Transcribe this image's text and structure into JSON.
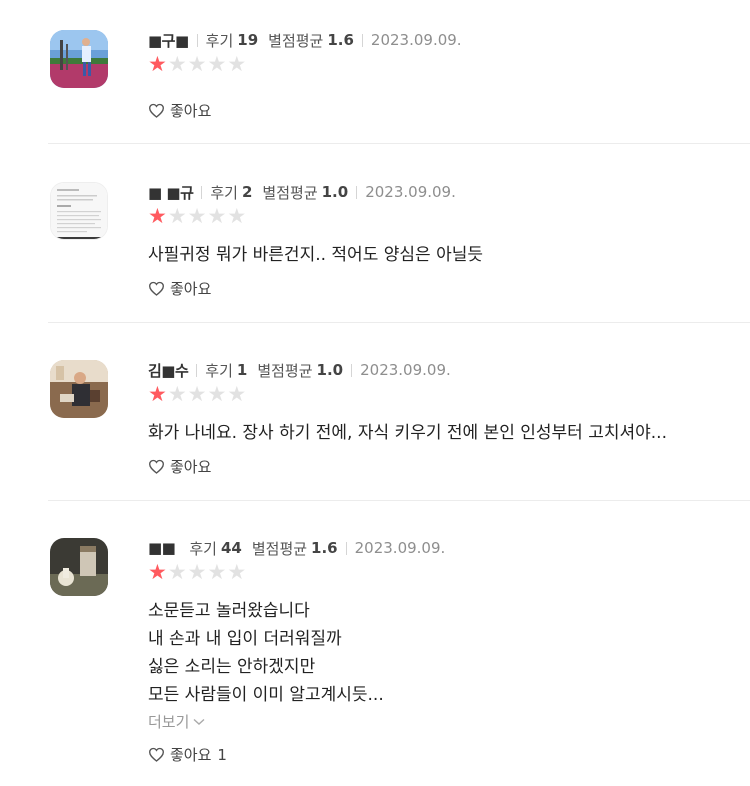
{
  "labels": {
    "reviews_prefix": "후기",
    "rating_avg_prefix": "별점평균",
    "like_label": "좋아요",
    "more_label": "더보기"
  },
  "colors": {
    "star_filled": "#ff5a5f",
    "star_empty": "#e2e2e2",
    "divider": "#ececec"
  },
  "reviews": [
    {
      "username": "■구■",
      "review_count": "19",
      "avg_rating": "1.6",
      "date": "2023.09.09.",
      "stars_filled": 1,
      "stars_total": 5,
      "text_lines": [],
      "like_count": "",
      "avatar_icon": "avatar-photo-person-outdoor"
    },
    {
      "username": "■ ■규",
      "review_count": "2",
      "avg_rating": "1.0",
      "date": "2023.09.09.",
      "stars_filled": 1,
      "stars_total": 5,
      "text_lines": [
        "사필귀정 뭐가 바른건지.. 적어도 양심은 아닐듯"
      ],
      "like_count": "",
      "avatar_icon": "avatar-document-image"
    },
    {
      "username": "김■수",
      "review_count": "1",
      "avg_rating": "1.0",
      "date": "2023.09.09.",
      "stars_filled": 1,
      "stars_total": 5,
      "text_lines": [
        "화가 나네요. 장사 하기 전에, 자식 키우기 전에 본인 인성부터 고치셔야..."
      ],
      "like_count": "",
      "avatar_icon": "avatar-photo-person-indoor"
    },
    {
      "username": "■■",
      "review_count": "44",
      "avg_rating": "1.6",
      "date": "2023.09.09.",
      "stars_filled": 1,
      "stars_total": 5,
      "text_lines": [
        "소문듣고 놀러왔습니다",
        "내 손과 내 입이 더러워질까",
        "싫은 소리는 안하겠지만",
        "모든 사람들이 이미 알고계시듯..."
      ],
      "like_count": "1",
      "avatar_icon": "avatar-photo-drink"
    }
  ]
}
